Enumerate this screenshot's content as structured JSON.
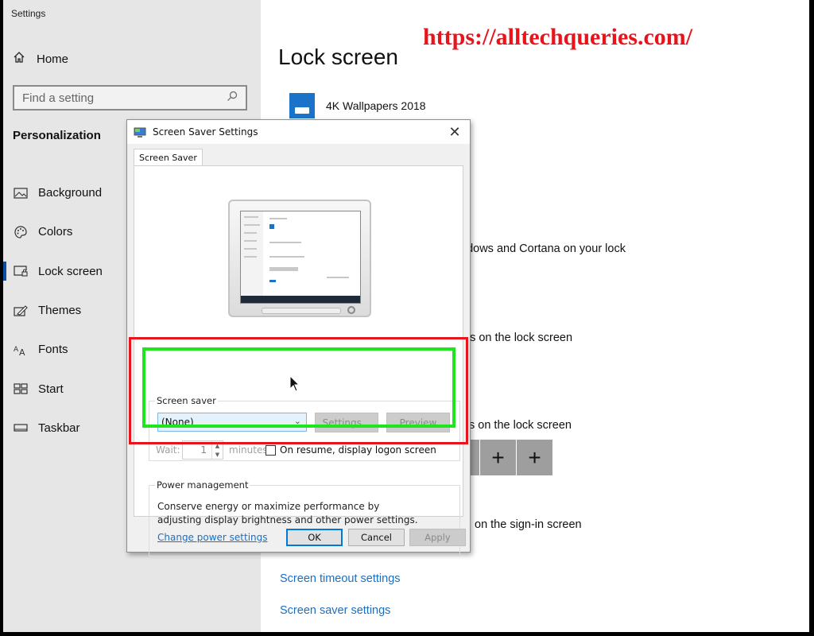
{
  "window": {
    "title": "Settings"
  },
  "sidebar": {
    "home_label": "Home",
    "search_placeholder": "Find a setting",
    "section_title": "Personalization",
    "items": [
      {
        "label": "Background",
        "icon": "picture-icon"
      },
      {
        "label": "Colors",
        "icon": "palette-icon"
      },
      {
        "label": "Lock screen",
        "icon": "lock-screen-icon",
        "active": true
      },
      {
        "label": "Themes",
        "icon": "brush-icon"
      },
      {
        "label": "Fonts",
        "icon": "fonts-icon"
      },
      {
        "label": "Start",
        "icon": "start-tiles-icon"
      },
      {
        "label": "Taskbar",
        "icon": "taskbar-icon"
      }
    ]
  },
  "main": {
    "title": "Lock screen",
    "watermark": "https://alltechqueries.com/",
    "app_item": "4K Wallpapers 2018",
    "partial_texts": [
      "ndows and Cortana on your lock",
      "tus on the lock screen",
      "s on the lock screen",
      "on the sign-in screen"
    ],
    "plus_label": "+",
    "links": {
      "screen_timeout": "Screen timeout settings",
      "screen_saver": "Screen saver settings"
    }
  },
  "dialog": {
    "title": "Screen Saver Settings",
    "close": "✕",
    "tab": "Screen Saver",
    "screen_saver_group": {
      "label": "Screen saver",
      "selected": "(None)",
      "settings_button": "Settings...",
      "preview_button": "Preview",
      "wait_label": "Wait:",
      "wait_value": "1",
      "minutes_label": "minutes",
      "resume_checkbox_label": "On resume, display logon screen",
      "resume_checked": false
    },
    "power_group": {
      "label": "Power management",
      "description": "Conserve energy or maximize performance by adjusting display brightness and other power settings.",
      "link": "Change power settings"
    },
    "buttons": {
      "ok": "OK",
      "cancel": "Cancel",
      "apply": "Apply"
    }
  },
  "colors": {
    "accent": "#0078d7",
    "watermark": "#e8141b",
    "highlight_red": "#e8141b",
    "highlight_green": "#1ee61e",
    "link": "#1a6fc4"
  }
}
